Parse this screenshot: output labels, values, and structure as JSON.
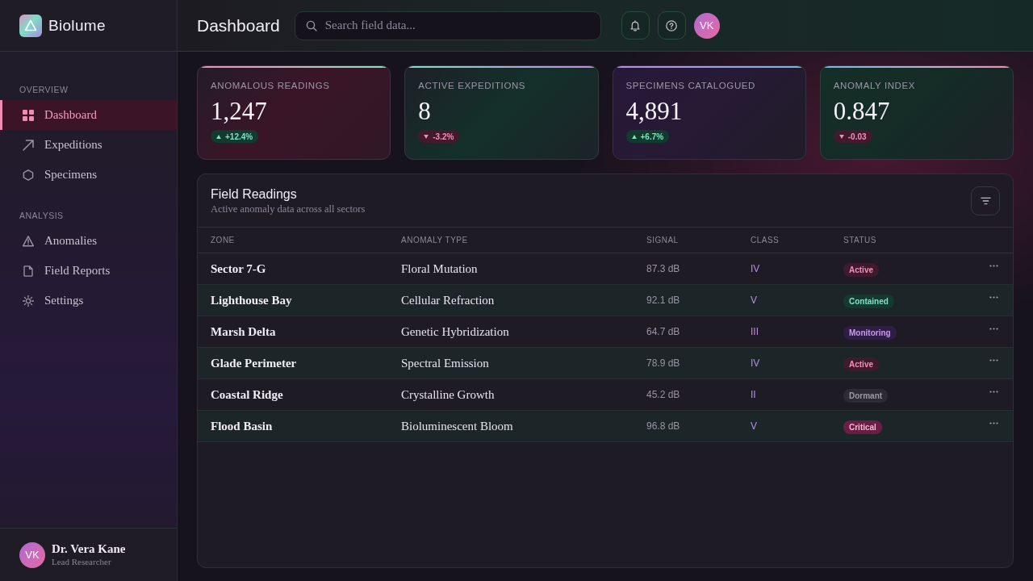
{
  "brand": {
    "name": "Biolume"
  },
  "sidebar": {
    "sections": [
      {
        "title": "OVERVIEW",
        "items": [
          {
            "label": "Dashboard",
            "selected": true
          },
          {
            "label": "Expeditions",
            "selected": false
          },
          {
            "label": "Specimens",
            "selected": false
          }
        ]
      },
      {
        "title": "ANALYSIS",
        "items": [
          {
            "label": "Anomalies",
            "selected": false
          },
          {
            "label": "Field Reports",
            "selected": false
          },
          {
            "label": "Settings",
            "selected": false
          }
        ]
      }
    ],
    "user": {
      "initials": "VK",
      "name": "Dr. Vera Kane",
      "role": "Lead Researcher"
    }
  },
  "header": {
    "title": "Dashboard",
    "search": {
      "placeholder": "Search field data..."
    },
    "avatar": {
      "initials": "VK"
    }
  },
  "stats": [
    {
      "label": "ANOMALOUS READINGS",
      "value": "1,247",
      "change": "+12.4%",
      "up": true
    },
    {
      "label": "ACTIVE EXPEDITIONS",
      "value": "8",
      "change": "-3.2%",
      "up": false
    },
    {
      "label": "SPECIMENS CATALOGUED",
      "value": "4,891",
      "change": "+6.7%",
      "up": true
    },
    {
      "label": "ANOMALY INDEX",
      "value": "0.847",
      "change": "-0.03",
      "up": false
    }
  ],
  "table": {
    "title": "Field Readings",
    "subtitle": "Active anomaly data across all sectors",
    "columns": [
      "ZONE",
      "ANOMALY TYPE",
      "SIGNAL",
      "CLASS",
      "STATUS"
    ],
    "rows": [
      {
        "zone": "Sector 7-G",
        "anomaly_type": "Floral Mutation",
        "signal": "87.3 dB",
        "class": "IV",
        "status": {
          "label": "Active",
          "kind": "active"
        }
      },
      {
        "zone": "Lighthouse Bay",
        "anomaly_type": "Cellular Refraction",
        "signal": "92.1 dB",
        "class": "V",
        "status": {
          "label": "Contained",
          "kind": "contained"
        }
      },
      {
        "zone": "Marsh Delta",
        "anomaly_type": "Genetic Hybridization",
        "signal": "64.7 dB",
        "class": "III",
        "status": {
          "label": "Monitoring",
          "kind": "monitoring"
        }
      },
      {
        "zone": "Glade Perimeter",
        "anomaly_type": "Spectral Emission",
        "signal": "78.9 dB",
        "class": "IV",
        "status": {
          "label": "Active",
          "kind": "active"
        }
      },
      {
        "zone": "Coastal Ridge",
        "anomaly_type": "Crystalline Growth",
        "signal": "45.2 dB",
        "class": "II",
        "status": {
          "label": "Dormant",
          "kind": "dormant"
        }
      },
      {
        "zone": "Flood Basin",
        "anomaly_type": "Bioluminescent Bloom",
        "signal": "96.8 dB",
        "class": "V",
        "status": {
          "label": "Critical",
          "kind": "critical"
        }
      }
    ]
  }
}
